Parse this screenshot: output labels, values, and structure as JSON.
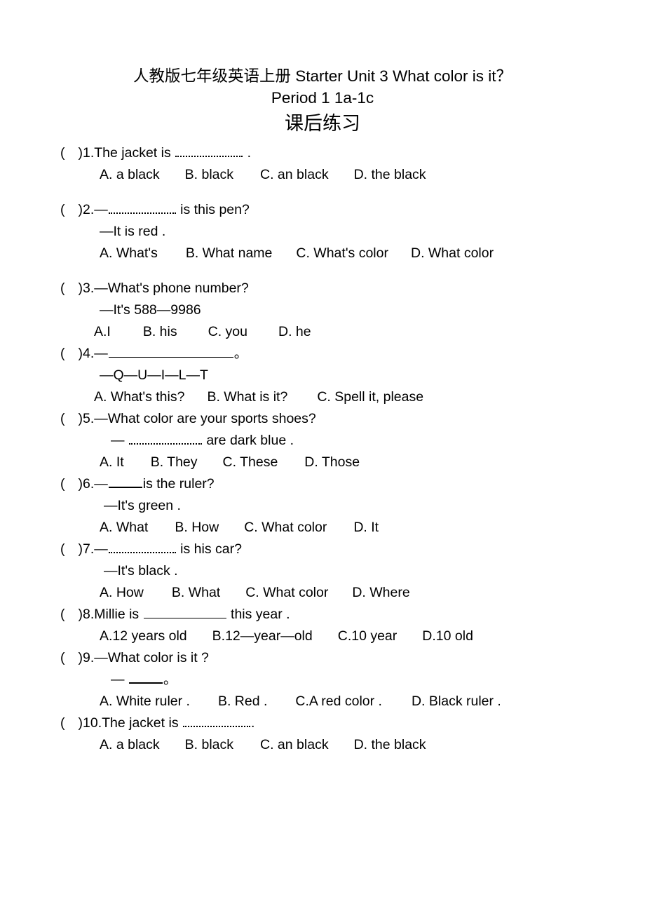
{
  "document": {
    "title": "人教版七年级英语上册 Starter Unit 3 What color is it？",
    "subtitle": "Period 1 1a-1c",
    "heading": "课后练习"
  },
  "questions": [
    {
      "id": "q1",
      "marker_open": "(",
      "marker_close": ")",
      "number": "1.",
      "stem_before": "The jacket is ",
      "stem_after": " .",
      "blank_style": "dotted",
      "blank_width": "w-medium",
      "options": [
        "A. a black",
        "B. black",
        "C. an black",
        "D. the black"
      ]
    },
    {
      "id": "q2",
      "marker_open": "(",
      "marker_close": ")",
      "number": "2.",
      "stem_before": "—",
      "stem_after": " is this pen?",
      "blank_style": "dotted",
      "blank_width": "w-medium",
      "reply": "—It is red .",
      "options": [
        "A. What's",
        "B. What name",
        "C. What's color",
        "D. What color"
      ]
    },
    {
      "id": "q3",
      "marker_open": "(",
      "marker_close": ")",
      "number": "3.",
      "stem": "—What's phone number?",
      "reply": "—It's 588—9986",
      "options": [
        "A.I",
        "B. his",
        "C. you",
        "D. he"
      ]
    },
    {
      "id": "q4",
      "marker_open": "(",
      "marker_close": ")",
      "number": "4.",
      "stem_before": "—",
      "stem_after": "。",
      "blank_style": "solid",
      "blank_width": "w-xlong",
      "reply": "—Q—U—I—L—T",
      "options": [
        "A. What's this?",
        "B. What is it?",
        "C. Spell it, please"
      ]
    },
    {
      "id": "q5",
      "marker_open": "(",
      "marker_close": ")",
      "number": "5.",
      "stem": "—What color are your sports shoes?",
      "reply_before": "— ",
      "reply_after": " are dark blue .",
      "blank_style": "dotted",
      "blank_width": "w-med2",
      "options": [
        "A. It",
        "B. They",
        "C. These",
        "D. Those"
      ]
    },
    {
      "id": "q6",
      "marker_open": "(",
      "marker_close": ")",
      "number": "6.",
      "stem_before": "—",
      "stem_after": "is the ruler?",
      "blank_style": "thick",
      "blank_width": "w-short",
      "reply": "—It's green .",
      "options": [
        "A. What",
        "B. How",
        "C. What color",
        "D. It"
      ]
    },
    {
      "id": "q7",
      "marker_open": "(",
      "marker_close": ")",
      "number": "7.",
      "stem_before": "—",
      "stem_after": " is his car?",
      "blank_style": "dotted",
      "blank_width": "w-medium",
      "reply": "—It's black .",
      "options": [
        "A. How",
        "B. What",
        "C. What color",
        "D. Where"
      ]
    },
    {
      "id": "q8",
      "marker_open": "(",
      "marker_close": ")",
      "number": "8.",
      "stem_before": "Millie is ",
      "stem_after": " this year .",
      "blank_style": "solid",
      "blank_width": "w-long",
      "options": [
        "A.12 years old",
        "B.12—year—old",
        "C.10 year",
        "D.10 old"
      ]
    },
    {
      "id": "q9",
      "marker_open": "(",
      "marker_close": ")",
      "number": "9.",
      "stem": "—What color is it ?",
      "reply_before": "— ",
      "reply_after": "。",
      "blank_style": "thick",
      "blank_width": "w-short",
      "options": [
        "A. White ruler .",
        "B. Red .",
        "C.A red color .",
        "D. Black ruler ."
      ]
    },
    {
      "id": "q10",
      "marker_open": "(",
      "marker_close": ")",
      "number": "10.",
      "stem_before": "The jacket is ",
      "stem_after": ".",
      "blank_style": "dotted",
      "blank_width": "w-medium",
      "options": [
        "A. a black",
        "B. black",
        "C. an black",
        "D. the black"
      ]
    }
  ]
}
